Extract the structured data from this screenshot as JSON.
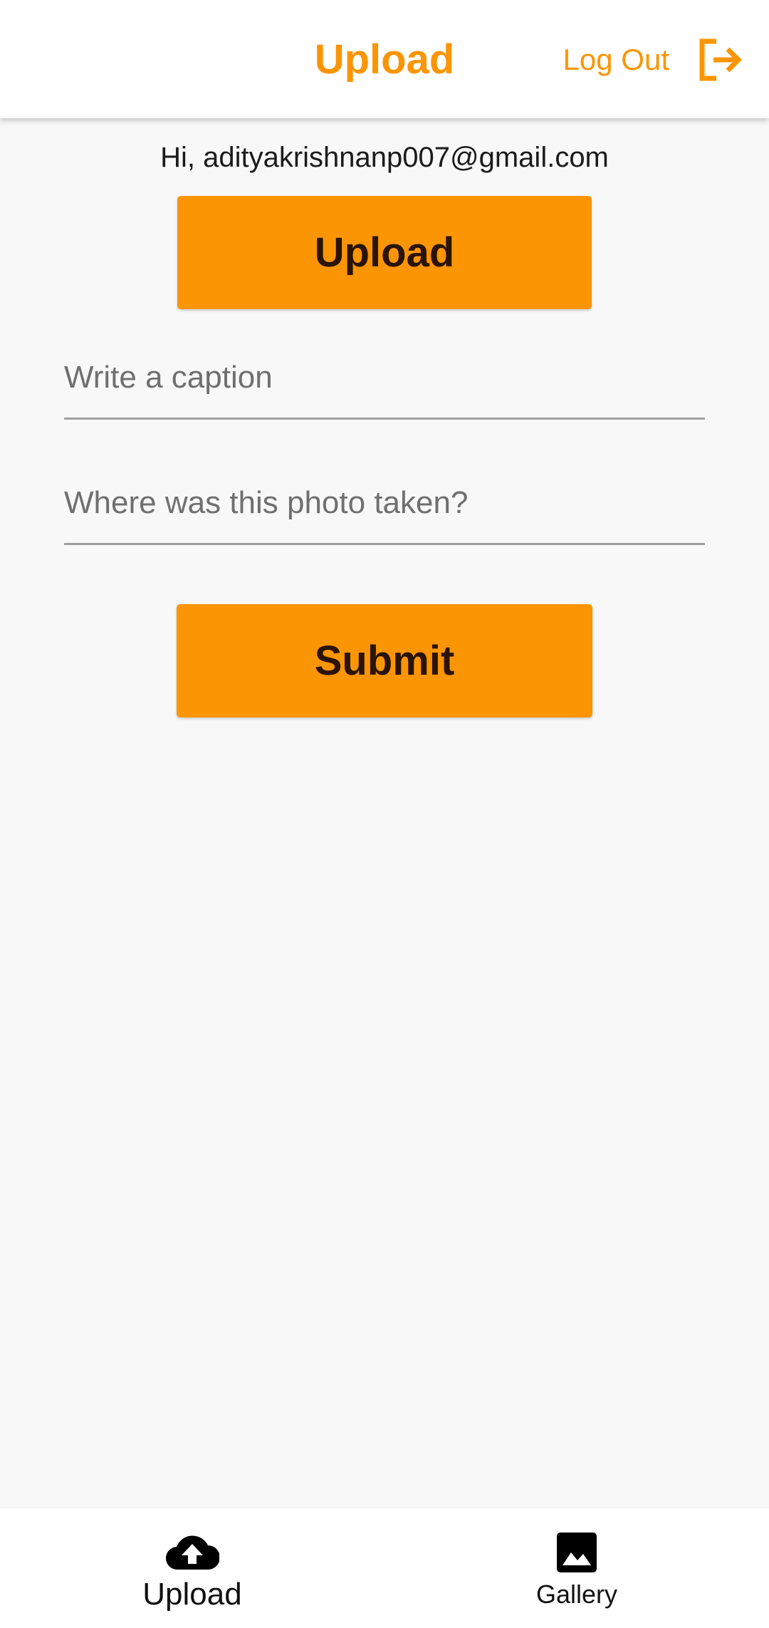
{
  "app_bar": {
    "title": "Upload",
    "logout_label": "Log Out",
    "logout_icon": "logout-icon"
  },
  "greeting": "Hi, adityakrishnanp007@gmail.com",
  "upload_button_label": "Upload",
  "form": {
    "caption": {
      "placeholder": "Write a caption",
      "value": ""
    },
    "location": {
      "placeholder": "Where was this photo taken?",
      "value": ""
    }
  },
  "submit_button_label": "Submit",
  "bottom_nav": {
    "items": [
      {
        "label": "Upload",
        "icon": "cloud-upload-icon",
        "selected": true
      },
      {
        "label": "Gallery",
        "icon": "image-icon",
        "selected": false
      }
    ]
  },
  "colors": {
    "accent": "#fb9504",
    "button_text": "#2a1406",
    "background": "#f8f8f8"
  }
}
